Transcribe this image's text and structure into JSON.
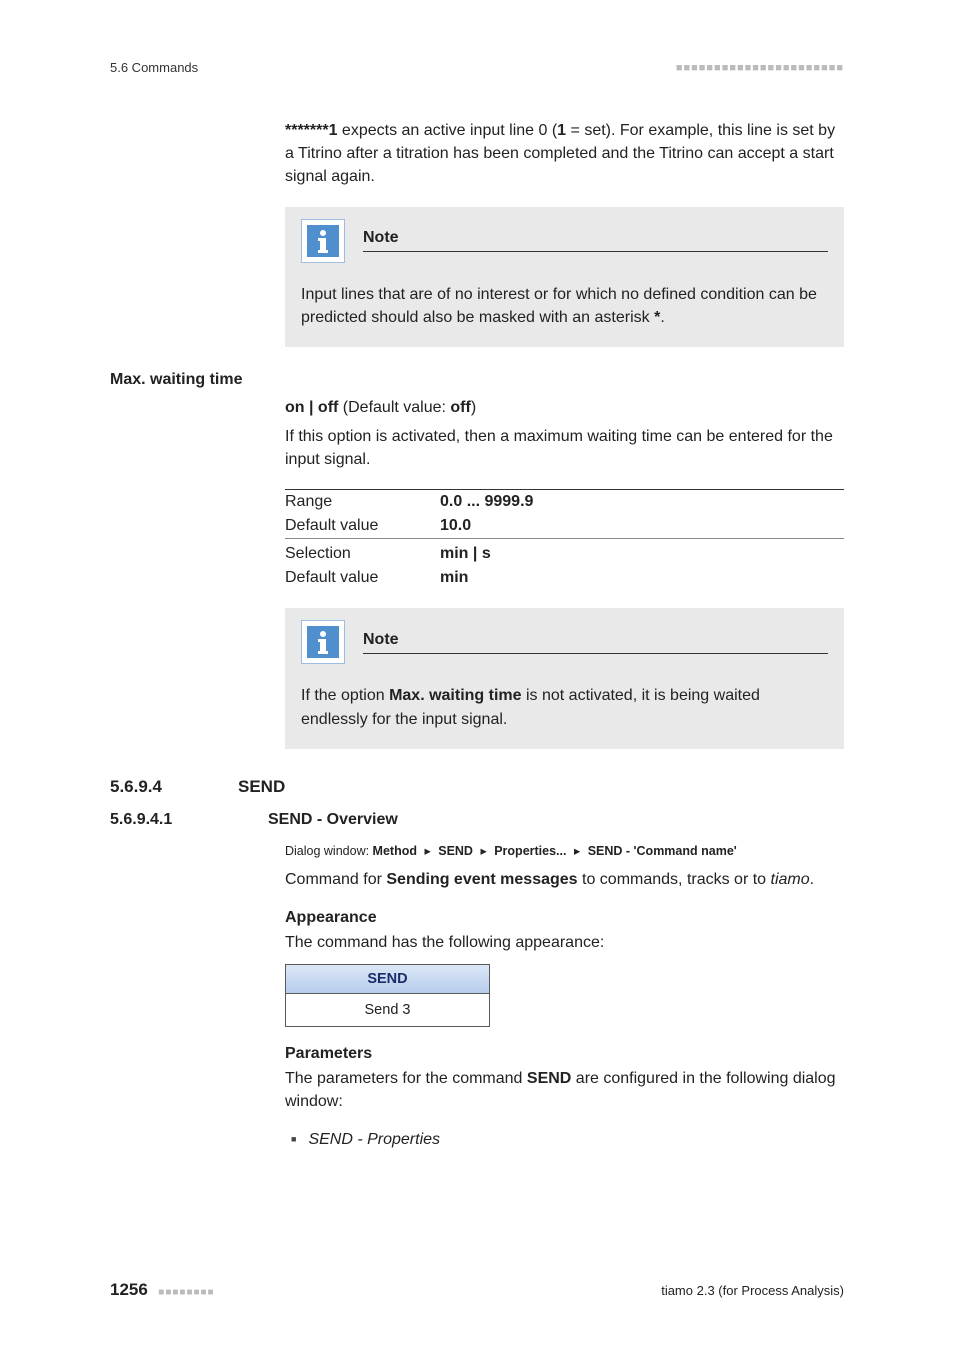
{
  "header": {
    "left": "5.6 Commands",
    "dots": "■■■■■■■■■■■■■■■■■■■■■■"
  },
  "p1": {
    "lead_bold": "*******1",
    "t1": " expects an active input line 0 (",
    "bold1": "1",
    "t2": " = set). For example, this line is set by a Titrino after a titration has been completed and the Titrino can accept a start signal again."
  },
  "note1": {
    "title": "Note",
    "t1": "Input lines that are of no interest or for which no defined condition can be predicted should also be masked with an asterisk ",
    "bold1": "*",
    "t2": "."
  },
  "mwt": {
    "heading": "Max. waiting time",
    "onoff_lead": "on | off",
    "onoff_mid": " (Default value: ",
    "onoff_bold": "off",
    "onoff_tail": ")",
    "desc": "If this option is activated, then a maximum waiting time can be entered for the input signal.",
    "r1_label": "Range",
    "r1_val": "0.0 ... 9999.9",
    "r2_label": "Default value",
    "r2_val": "10.0",
    "r3_label": "Selection",
    "r3_val": "min | s",
    "r4_label": "Default value",
    "r4_val": "min"
  },
  "note2": {
    "title": "Note",
    "t1": "If the option ",
    "bold1": "Max. waiting time",
    "t2": " is not activated, it is being waited endlessly for the input signal."
  },
  "sec1": {
    "num": "5.6.9.4",
    "title": "SEND"
  },
  "sec2": {
    "num": "5.6.9.4.1",
    "title": "SEND - Overview"
  },
  "dialog": {
    "lead": "Dialog window: ",
    "b1": "Method",
    "b2": "SEND",
    "b3": "Properties...",
    "b4": "SEND - 'Command name'"
  },
  "cmdfor": {
    "t1": "Command for ",
    "bold1": "Sending event messages",
    "t2": " to commands, tracks or to ",
    "it1": "tiamo",
    "t3": "."
  },
  "appearance": {
    "h": "Appearance",
    "desc": "The command has the following appearance:"
  },
  "widget": {
    "top": "SEND",
    "bottom": "Send 3"
  },
  "params": {
    "h": "Parameters",
    "t1": "The parameters for the command ",
    "bold1": "SEND",
    "t2": " are configured in the following dialog window:",
    "item1": "SEND - Properties"
  },
  "footer": {
    "page": "1256",
    "dots": "■■■■■■■■",
    "right": "tiamo 2.3 (for Process Analysis)"
  }
}
